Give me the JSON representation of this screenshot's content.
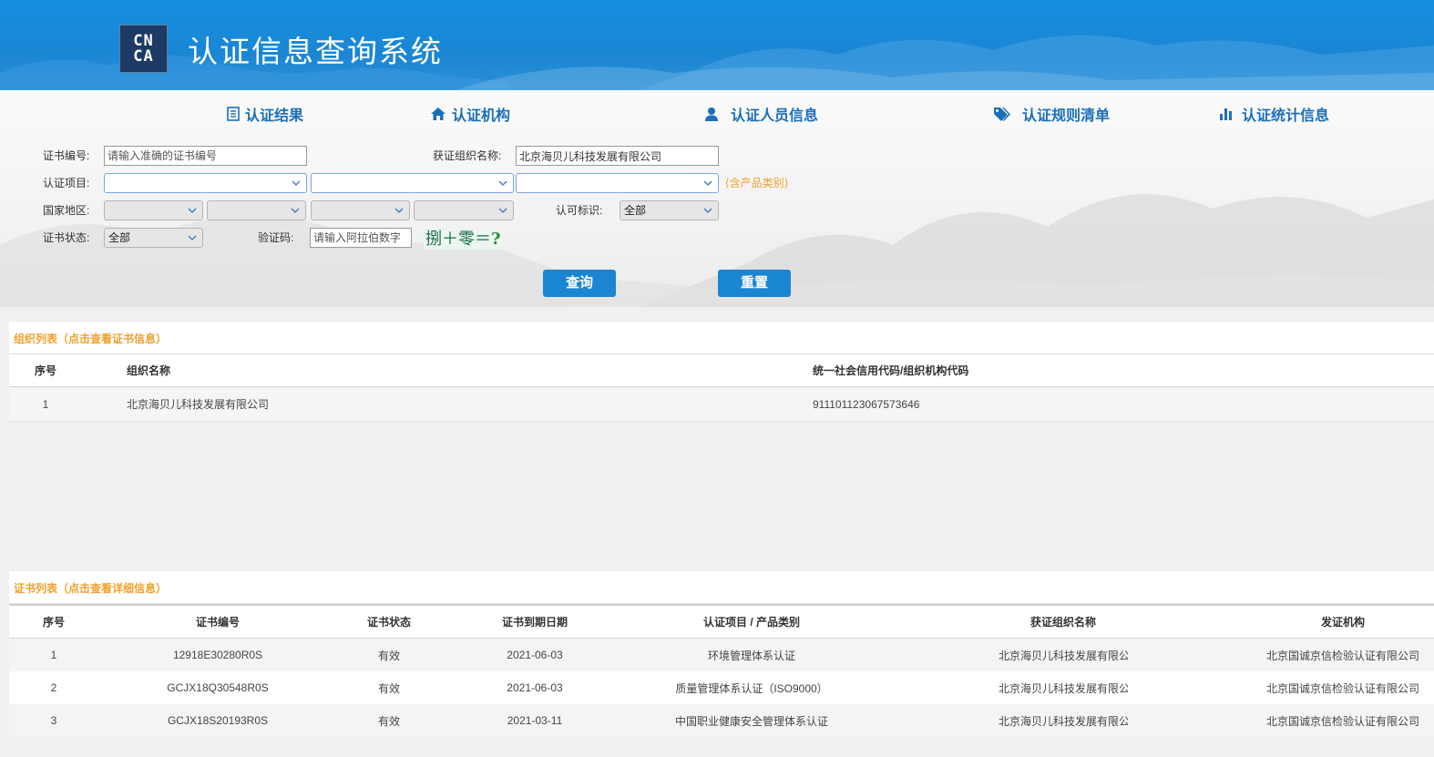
{
  "header": {
    "logo_top": "CN",
    "logo_bottom": "CA",
    "title": "认证信息查询系统"
  },
  "nav": [
    {
      "label": "认证结果",
      "icon": "list-icon"
    },
    {
      "label": "认证机构",
      "icon": "home-icon"
    },
    {
      "label": "认证人员信息",
      "icon": "user-icon"
    },
    {
      "label": "认证规则清单",
      "icon": "tags-icon"
    },
    {
      "label": "认证统计信息",
      "icon": "bar-chart-icon"
    }
  ],
  "form": {
    "cert_no_label": "证书编号:",
    "cert_no_placeholder": "请输入准确的证书编号",
    "org_name_label": "获证组织名称:",
    "org_name_value": "北京海贝儿科技发展有限公司",
    "project_label": "认证项目:",
    "product_hint": "(含产品类别)",
    "region_label": "国家地区:",
    "accred_label": "认可标识:",
    "accred_value": "全部",
    "status_label": "证书状态:",
    "status_value": "全部",
    "captcha_label": "验证码:",
    "captcha_placeholder": "请输入阿拉伯数字",
    "captcha_text": "捌＋零＝",
    "captcha_q": "?",
    "query_button": "查询",
    "reset_button": "重置"
  },
  "org_list": {
    "title": "组织列表（点击查看证书信息）",
    "headers": [
      "序号",
      "组织名称",
      "统一社会信用代码/组织机构代码"
    ],
    "rows": [
      [
        "1",
        "北京海贝儿科技发展有限公司",
        "911101123067573646"
      ]
    ]
  },
  "cert_list": {
    "title": "证书列表（点击查看详细信息）",
    "headers": [
      "序号",
      "证书编号",
      "证书状态",
      "证书到期日期",
      "认证项目 / 产品类别",
      "获证组织名称",
      "发证机构"
    ],
    "rows": [
      [
        "1",
        "12918E30280R0S",
        "有效",
        "2021-06-03",
        "环境管理体系认证",
        "北京海贝儿科技发展有限公司",
        "北京国诚京信检验认证有限公司"
      ],
      [
        "2",
        "GCJX18Q30548R0S",
        "有效",
        "2021-06-03",
        "质量管理体系认证（ISO9000）",
        "北京海贝儿科技发展有限公司",
        "北京国诚京信检验认证有限公司"
      ],
      [
        "3",
        "GCJX18S20193R0S",
        "有效",
        "2021-03-11",
        "中国职业健康安全管理体系认证",
        "北京海贝儿科技发展有限公司",
        "北京国诚京信检验认证有限公司"
      ]
    ]
  },
  "colors": {
    "header_blue": "#1590df",
    "nav_blue": "#1b6fb8",
    "button_blue": "#1a86d2",
    "accent_orange": "#f0a12c"
  }
}
